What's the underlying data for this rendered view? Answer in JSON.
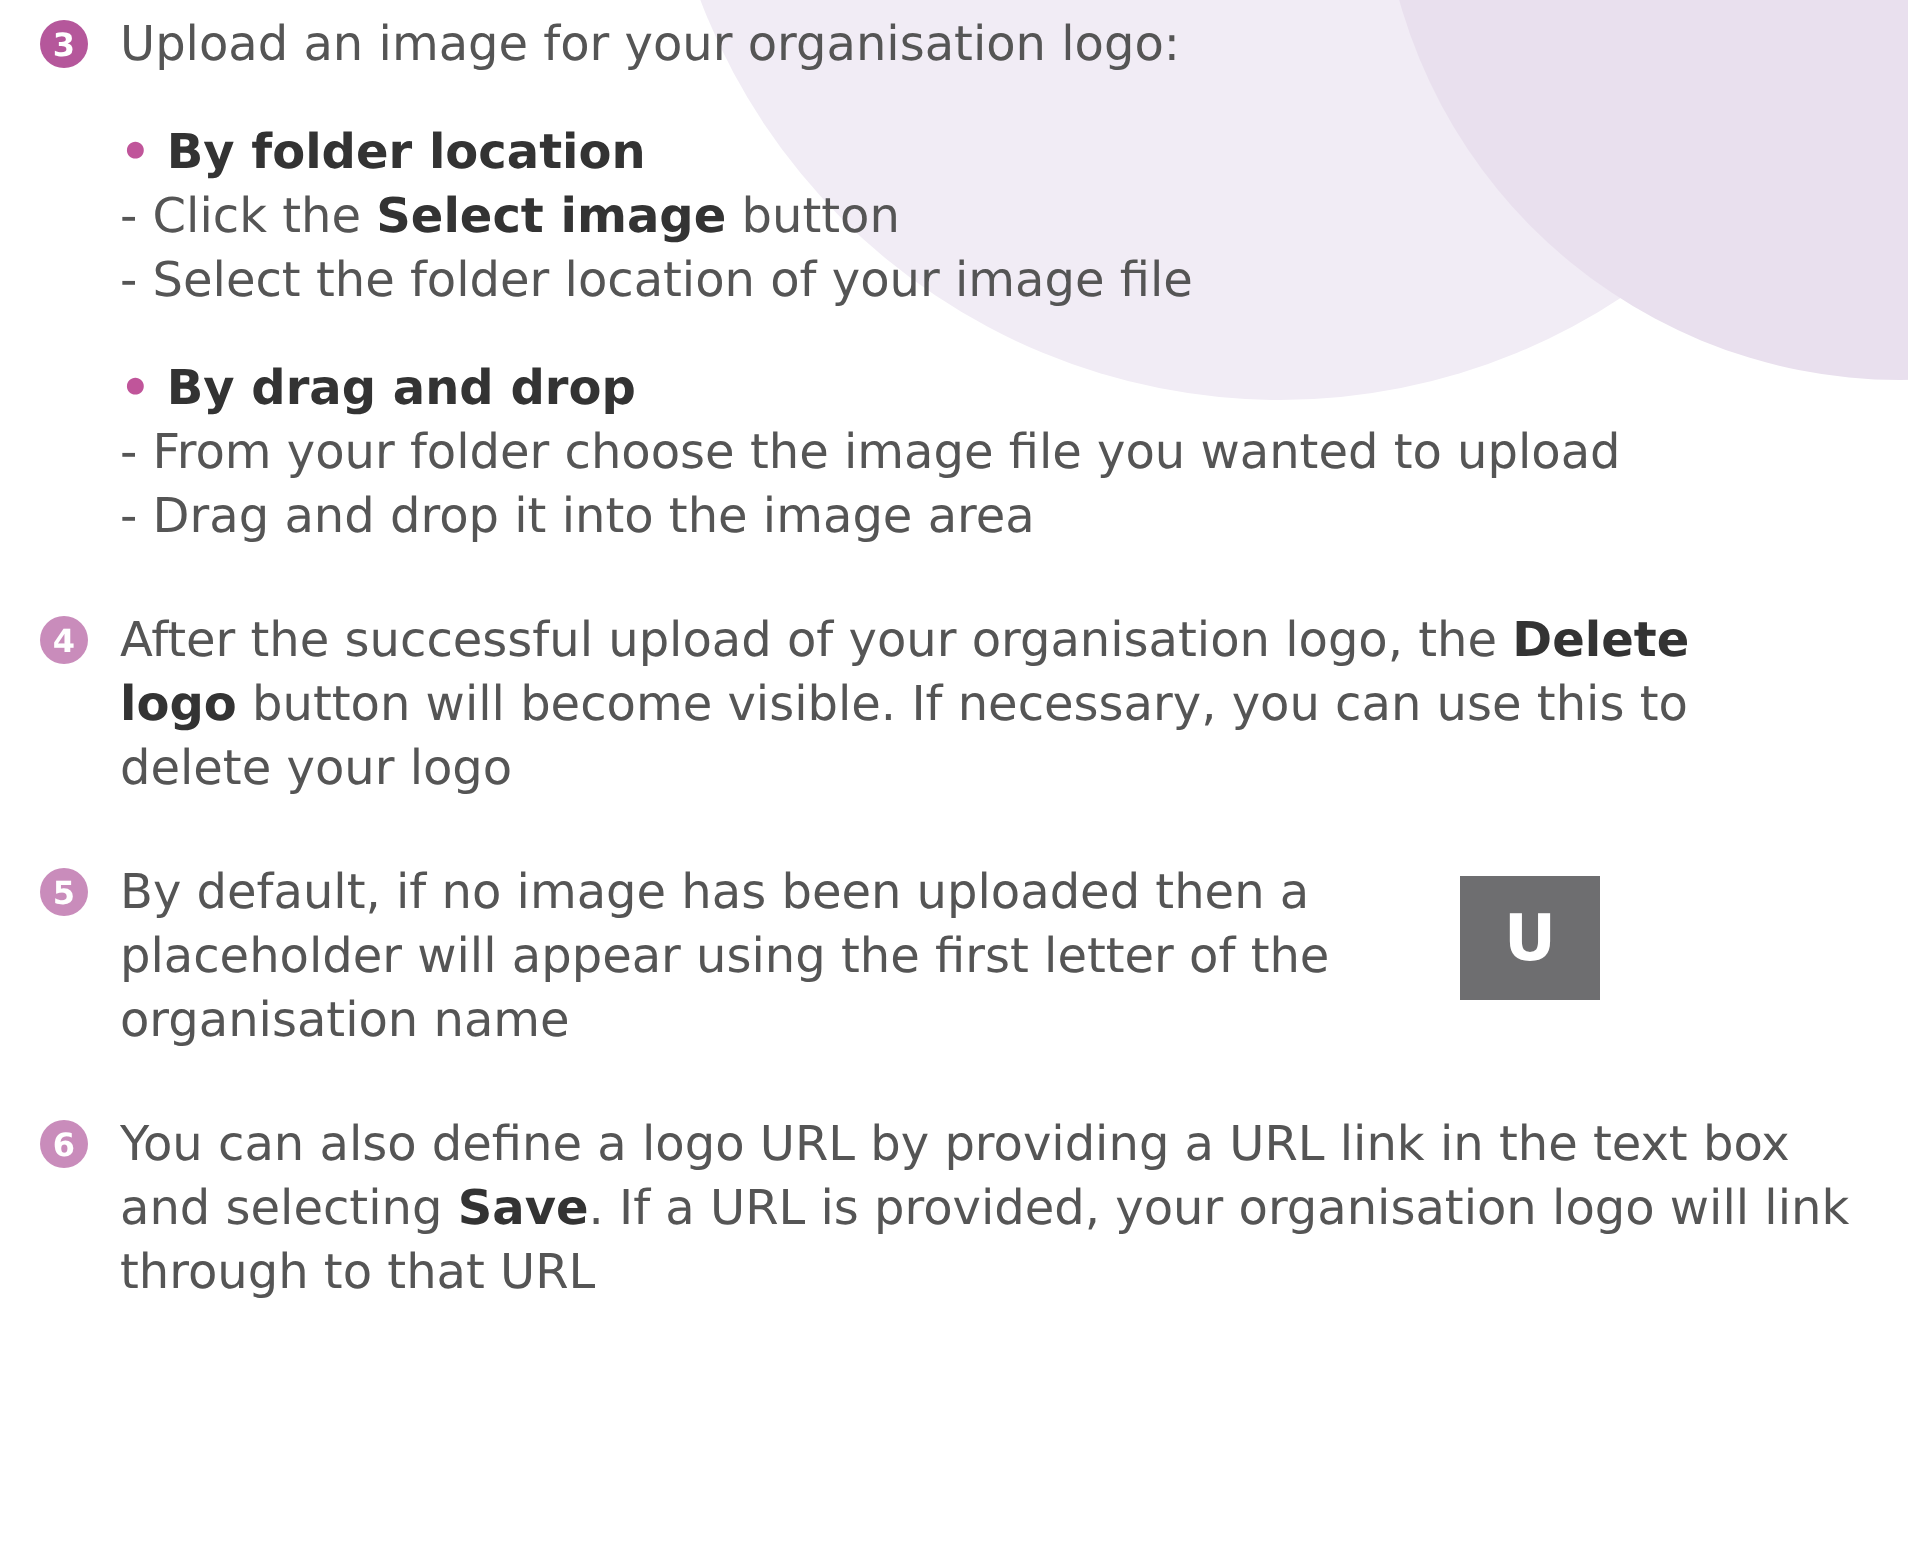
{
  "steps": [
    {
      "number": "3",
      "color": "#b5579b",
      "text": "Upload an image for your organisation logo:",
      "sections": [
        {
          "bullet": "•",
          "heading": "By folder location",
          "lines": [
            "- Click the **Select image** button",
            "- Select the folder location of your image file"
          ]
        },
        {
          "bullet": "•",
          "heading": "By drag and drop",
          "lines": [
            "- From your folder choose the image file you wanted to upload",
            "- Drag and drop it into the image area"
          ]
        }
      ]
    },
    {
      "number": "4",
      "color": "#c98cbb",
      "text": "After the successful upload of your organisation logo, the **Delete logo** button will become visible. If necessary, you can use this to delete your logo"
    },
    {
      "number": "5",
      "color": "#c98cbb",
      "text": "By default, if no image has been uploaded then a placeholder will appear using the first letter of the organisation name",
      "placeholder_letter": "U"
    },
    {
      "number": "6",
      "color": "#c98cbb",
      "text": "You can also define a logo URL by providing a URL link in the text box and selecting **Save**. If a URL is provided, your organisation logo will link through to that URL"
    }
  ]
}
